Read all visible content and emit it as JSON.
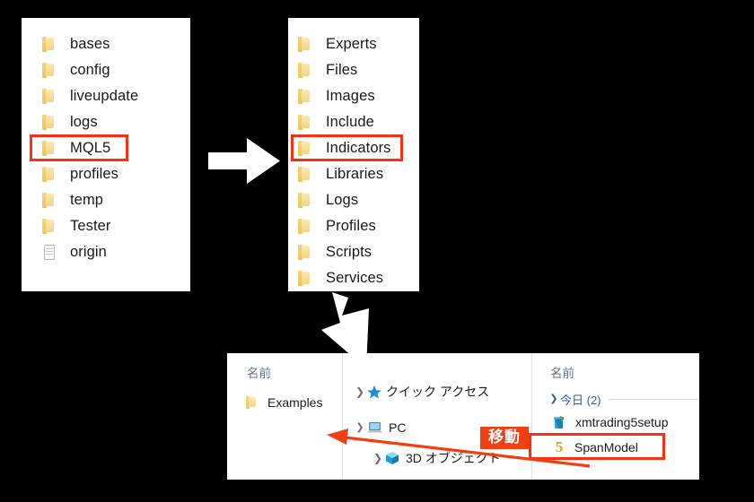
{
  "meta": {
    "background_color": "#000000",
    "panel_color": "#ffffff",
    "highlight_color": "#fb2f13",
    "badge_color": "#f03f12",
    "arrow_color": "#ffffff"
  },
  "panel1": {
    "name": "mql-data-folder-list",
    "items": [
      {
        "label": "bases",
        "icon": "folder-icon",
        "highlighted": false
      },
      {
        "label": "config",
        "icon": "folder-icon",
        "highlighted": false
      },
      {
        "label": "liveupdate",
        "icon": "folder-icon",
        "highlighted": false
      },
      {
        "label": "logs",
        "icon": "folder-icon",
        "highlighted": false
      },
      {
        "label": "MQL5",
        "icon": "folder-icon",
        "highlighted": true
      },
      {
        "label": "profiles",
        "icon": "folder-icon",
        "highlighted": false
      },
      {
        "label": "temp",
        "icon": "folder-icon",
        "highlighted": false
      },
      {
        "label": "Tester",
        "icon": "folder-icon",
        "highlighted": false
      },
      {
        "label": "origin",
        "icon": "document-icon",
        "highlighted": false
      }
    ]
  },
  "panel2": {
    "name": "mql5-subfolder-list",
    "items": [
      {
        "label": "Experts",
        "icon": "folder-icon",
        "highlighted": false
      },
      {
        "label": "Files",
        "icon": "folder-icon",
        "highlighted": false
      },
      {
        "label": "Images",
        "icon": "folder-icon",
        "highlighted": false
      },
      {
        "label": "Include",
        "icon": "folder-icon",
        "highlighted": false
      },
      {
        "label": "Indicators",
        "icon": "folder-icon",
        "highlighted": true
      },
      {
        "label": "Libraries",
        "icon": "folder-icon",
        "highlighted": false
      },
      {
        "label": "Logs",
        "icon": "folder-icon",
        "highlighted": false
      },
      {
        "label": "Profiles",
        "icon": "folder-icon",
        "highlighted": false
      },
      {
        "label": "Scripts",
        "icon": "folder-icon",
        "highlighted": false
      },
      {
        "label": "Services",
        "icon": "folder-icon",
        "highlighted": false
      }
    ]
  },
  "arrows": {
    "step1": {
      "name": "arrow-right",
      "direction": "right"
    },
    "step2": {
      "name": "arrow-down-right",
      "direction": "down-right"
    },
    "move": {
      "name": "move-arrow",
      "direction": "left",
      "color": "#f03f12"
    }
  },
  "badge": {
    "label": "移動"
  },
  "explorer": {
    "indicators_pane": {
      "column_header": "名前",
      "items": [
        {
          "label": "Examples",
          "icon": "folder-icon"
        }
      ]
    },
    "nav_pane": {
      "items": [
        {
          "label": "クイック アクセス",
          "icon": "star-icon",
          "chevron": "collapsed",
          "indent": 0
        },
        {
          "label": "PC",
          "icon": "pc-icon",
          "chevron": "expanded",
          "indent": 0
        },
        {
          "label": "3D オブジェクト",
          "icon": "cube-icon",
          "chevron": "collapsed",
          "indent": 1
        }
      ]
    },
    "downloads_pane": {
      "column_header": "名前",
      "group_header": "今日 (2)",
      "items": [
        {
          "label": "xmtrading5setup",
          "icon": "setup-icon",
          "highlighted": false
        },
        {
          "label": "SpanModel",
          "icon": "mq5-icon",
          "highlighted": true
        }
      ]
    }
  }
}
